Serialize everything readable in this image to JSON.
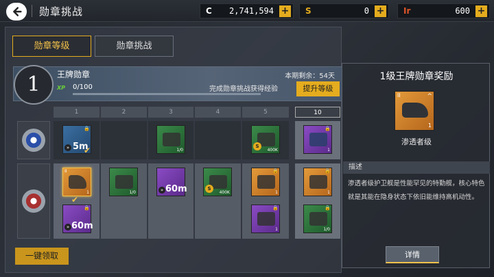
{
  "header": {
    "title": "勋章挑战",
    "currencies": [
      {
        "icon": "C",
        "value": "2,741,594",
        "color": "#ffffff"
      },
      {
        "icon": "S",
        "value": "0",
        "color": "#e4ac1e"
      },
      {
        "icon": "Ir",
        "value": "600",
        "color": "#e0552a"
      }
    ],
    "plus": "+"
  },
  "tabs": [
    "勋章等级",
    "勋章挑战"
  ],
  "level": {
    "number": "1",
    "name": "王牌勋章",
    "remaining": "本期剩余：54天",
    "xp_tag": "XP",
    "xp": "0/100",
    "hint": "完成勋章挑战获得经验",
    "upgrade": "提升等级"
  },
  "grid": {
    "columns": [
      "1",
      "2",
      "3",
      "4",
      "5",
      "10"
    ],
    "rows": [
      {
        "badge": "standard-medal-icon",
        "items": [
          {
            "col": 0,
            "color": "blue",
            "text": "5m",
            "lock": true,
            "checked": true
          },
          {
            "col": 2,
            "color": "green",
            "qty": "1/0"
          },
          {
            "col": 4,
            "color": "green",
            "qty": "400K",
            "coin": true
          },
          {
            "col": 5,
            "color": "purple",
            "qty": "1",
            "lock": true
          }
        ]
      },
      {
        "badge": "ace-medal-icon",
        "items": [
          {
            "col": 0,
            "color": "blue",
            "qty": "1",
            "checked": true,
            "rank": "II"
          },
          {
            "col": 0,
            "color": "purple",
            "text": "60m",
            "lock": true,
            "row2": true
          },
          {
            "col": 1,
            "color": "green",
            "qty": "1/0"
          },
          {
            "col": 2,
            "color": "purple",
            "text": "60m"
          },
          {
            "col": 3,
            "color": "green",
            "qty": "400K",
            "coin": true
          },
          {
            "col": 4,
            "color": "gold",
            "qty": "1"
          },
          {
            "col": 4,
            "color": "purple",
            "qty": "1",
            "row2": true
          },
          {
            "col": 5,
            "color": "gold",
            "qty": "1"
          },
          {
            "col": 5,
            "color": "green",
            "qty": "1/0",
            "row2": true
          }
        ]
      }
    ],
    "claim_all": "一键领取"
  },
  "reward": {
    "title": "1级王牌勋章奖励",
    "item_rank": "II",
    "item_qty": "1",
    "item_name": "渗透者级",
    "desc_header": "描述",
    "description": "渗透者级护卫舰是性能罕见的特勤舰，核心特色就是其能在隐身状态下依旧能维持高机动性。",
    "detail": "详情"
  }
}
